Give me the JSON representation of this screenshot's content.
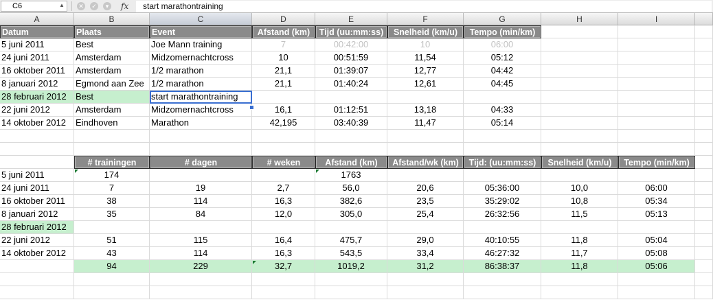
{
  "formula_bar": {
    "cell_ref": "C6",
    "formula": "start marathontraining",
    "fx_label": "fx"
  },
  "columns": [
    "A",
    "B",
    "C",
    "D",
    "E",
    "F",
    "G",
    "H",
    "I"
  ],
  "table1": {
    "headers": [
      "Datum",
      "Plaats",
      "Event",
      "Afstand (km)",
      "Tijd (uu:mm:ss)",
      "Snelheid (km/u)",
      "Tempo (min/km)"
    ],
    "rows": [
      [
        "5 juni 2011",
        "Best",
        "Joe Mann training",
        "7",
        "00:42:00",
        "10",
        "06:00"
      ],
      [
        "24 juni 2011",
        "Amsterdam",
        "Midzomernachtcross",
        "10",
        "00:51:59",
        "11,54",
        "05:12"
      ],
      [
        "16 oktober 2011",
        "Amsterdam",
        "1/2 marathon",
        "21,1",
        "01:39:07",
        "12,77",
        "04:42"
      ],
      [
        "8 januari 2012",
        "Egmond aan Zee",
        "1/2 marathon",
        "21,1",
        "01:40:24",
        "12,61",
        "04:45"
      ],
      [
        "28 februari 2012",
        "Best",
        "start marathontraining",
        "",
        "",
        "",
        ""
      ],
      [
        "22 juni 2012",
        "Amsterdam",
        "Midzomernachtcross",
        "16,1",
        "01:12:51",
        "13,18",
        "04:33"
      ],
      [
        "14 oktober 2012",
        "Eindhoven",
        "Marathon",
        "42,195",
        "03:40:39",
        "11,47",
        "05:14"
      ]
    ]
  },
  "table2": {
    "headers": [
      "# trainingen",
      "# dagen",
      "# weken",
      "Afstand (km)",
      "Afstand/wk (km)",
      "Tijd: (uu:mm:ss)",
      "Snelheid (km/u)",
      "Tempo (min/km)"
    ],
    "rows": [
      [
        "5 juni 2011",
        "174",
        "",
        "",
        "1763",
        "",
        "",
        "",
        ""
      ],
      [
        "24 juni 2011",
        "7",
        "19",
        "2,7",
        "56,0",
        "20,6",
        "05:36:00",
        "10,0",
        "06:00"
      ],
      [
        "16 oktober 2011",
        "38",
        "114",
        "16,3",
        "382,6",
        "23,5",
        "35:29:02",
        "10,8",
        "05:34"
      ],
      [
        "8 januari 2012",
        "35",
        "84",
        "12,0",
        "305,0",
        "25,4",
        "26:32:56",
        "11,5",
        "05:13"
      ],
      [
        "28 februari 2012",
        "",
        "",
        "",
        "",
        "",
        "",
        "",
        ""
      ],
      [
        "22 juni 2012",
        "51",
        "115",
        "16,4",
        "475,7",
        "29,0",
        "40:10:55",
        "11,8",
        "05:04"
      ],
      [
        "14 oktober 2012",
        "43",
        "114",
        "16,3",
        "543,5",
        "33,4",
        "46:27:32",
        "11,7",
        "05:08"
      ]
    ],
    "total": [
      "",
      "94",
      "229",
      "32,7",
      "1019,2",
      "31,2",
      "86:38:37",
      "11,8",
      "05:06"
    ]
  },
  "colors": {
    "header_fill": "#8a8a8a",
    "highlight_green": "#c6efce",
    "selection": "#3a6fd1"
  }
}
